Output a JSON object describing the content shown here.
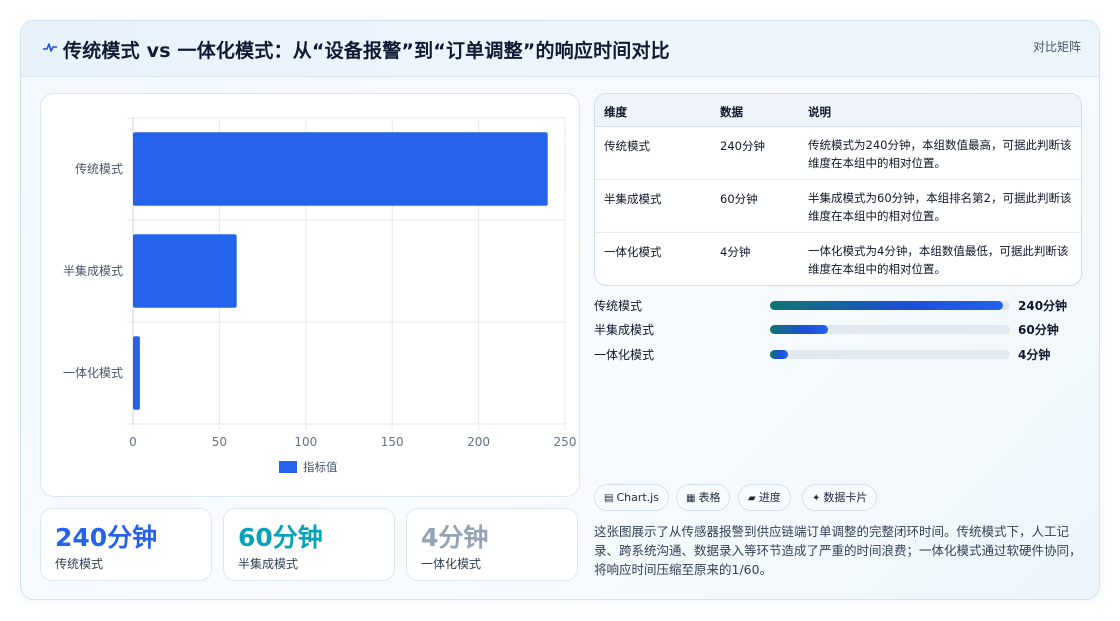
{
  "header": {
    "icon": "pulse-icon",
    "title": "传统模式 vs 一体化模式：从“设备报警”到“订单调整”的响应时间对比",
    "tag": "对比矩阵"
  },
  "chart_data": {
    "type": "bar",
    "orientation": "horizontal",
    "categories": [
      "传统模式",
      "半集成模式",
      "一体化模式"
    ],
    "series": [
      {
        "name": "指标值",
        "values": [
          240,
          60,
          4
        ],
        "color": "#2563eb"
      }
    ],
    "xlim": [
      0,
      250
    ],
    "xticks": [
      0,
      50,
      100,
      150,
      200,
      250
    ],
    "grid": true,
    "legend": "bottom"
  },
  "stats": [
    {
      "value": "240分钟",
      "label": "传统模式",
      "color": "#2563eb"
    },
    {
      "value": "60分钟",
      "label": "半集成模式",
      "color": "#06a3b8"
    },
    {
      "value": "4分钟",
      "label": "一体化模式",
      "color": "#94a3b8"
    }
  ],
  "table": {
    "headers": [
      "维度",
      "数据",
      "说明"
    ],
    "rows": [
      {
        "dim": "传统模式",
        "data": "240分钟",
        "desc": "传统模式为240分钟，本组数值最高，可据此判断该维度在本组中的相对位置。"
      },
      {
        "dim": "半集成模式",
        "data": "60分钟",
        "desc": "半集成模式为60分钟，本组排名第2，可据此判断该维度在本组中的相对位置。"
      },
      {
        "dim": "一体化模式",
        "data": "4分钟",
        "desc": "一体化模式为4分钟，本组数值最低，可据此判断该维度在本组中的相对位置。"
      }
    ]
  },
  "progress": [
    {
      "label": "传统模式",
      "value_text": "240分钟",
      "fraction": 0.97
    },
    {
      "label": "半集成模式",
      "value_text": "60分钟",
      "fraction": 0.24
    },
    {
      "label": "一体化模式",
      "value_text": "4分钟",
      "fraction": 0.075
    }
  ],
  "chips": [
    {
      "icon": "chart-icon",
      "glyph": "▤",
      "label": "Chart.js"
    },
    {
      "icon": "table-icon",
      "glyph": "▦",
      "label": "表格"
    },
    {
      "icon": "progress-icon",
      "glyph": "▰",
      "label": "进度"
    },
    {
      "icon": "sparkle-icon",
      "glyph": "✦",
      "label": "数据卡片"
    }
  ],
  "summary": "这张图展示了从传感器报警到供应链端订单调整的完整闭环时间。传统模式下，人工记录、跨系统沟通、数据录入等环节造成了严重的时间浪费；一体化模式通过软硬件协同，将响应时间压缩至原来的1/60。"
}
